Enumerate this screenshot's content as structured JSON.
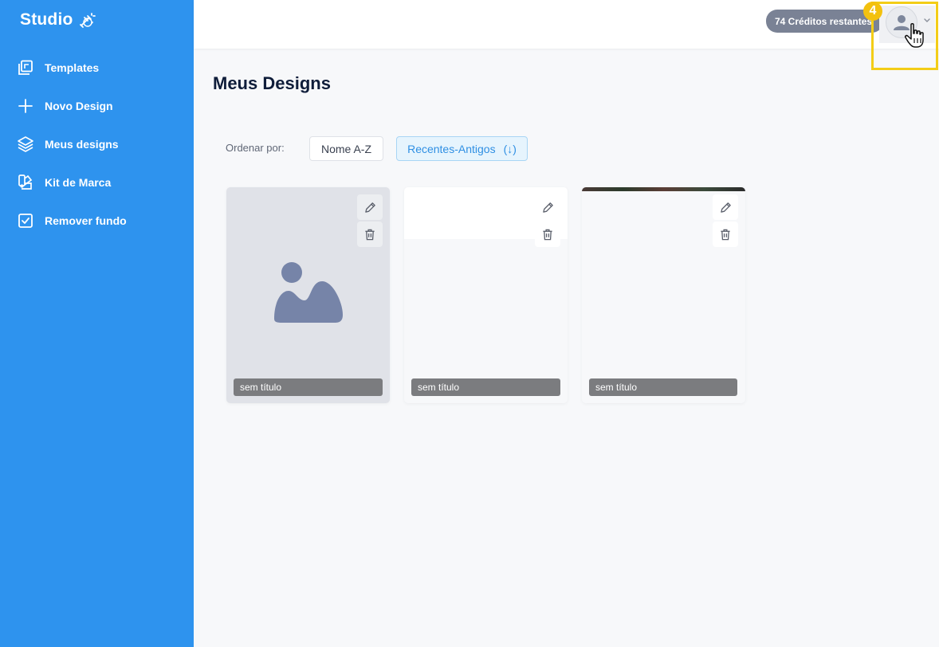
{
  "brand": {
    "name": "Studio"
  },
  "sidebar": {
    "items": [
      {
        "label": "Templates",
        "icon": "templates-icon"
      },
      {
        "label": "Novo Design",
        "icon": "plus-icon"
      },
      {
        "label": "Meus designs",
        "icon": "layers-icon"
      },
      {
        "label": "Kit de Marca",
        "icon": "brand-kit-icon"
      },
      {
        "label": "Remover fundo",
        "icon": "checkbox-icon"
      }
    ]
  },
  "topbar": {
    "credits": "74 Créditos restantes",
    "step_badge": "4"
  },
  "main": {
    "title": "Meus Designs",
    "sort": {
      "label": "Ordenar por:",
      "options": [
        {
          "label": "Nome A-Z",
          "active": false
        },
        {
          "label": "Recentes-Antigos",
          "suffix": "(↓)",
          "active": true
        }
      ]
    },
    "designs": [
      {
        "name": "sem título"
      },
      {
        "name": "sem título"
      },
      {
        "name": "sem título"
      }
    ]
  },
  "colors": {
    "sidebar_bg": "#2e93ee",
    "highlight": "#f3cd17",
    "active_sort": "#2f8fe3"
  }
}
